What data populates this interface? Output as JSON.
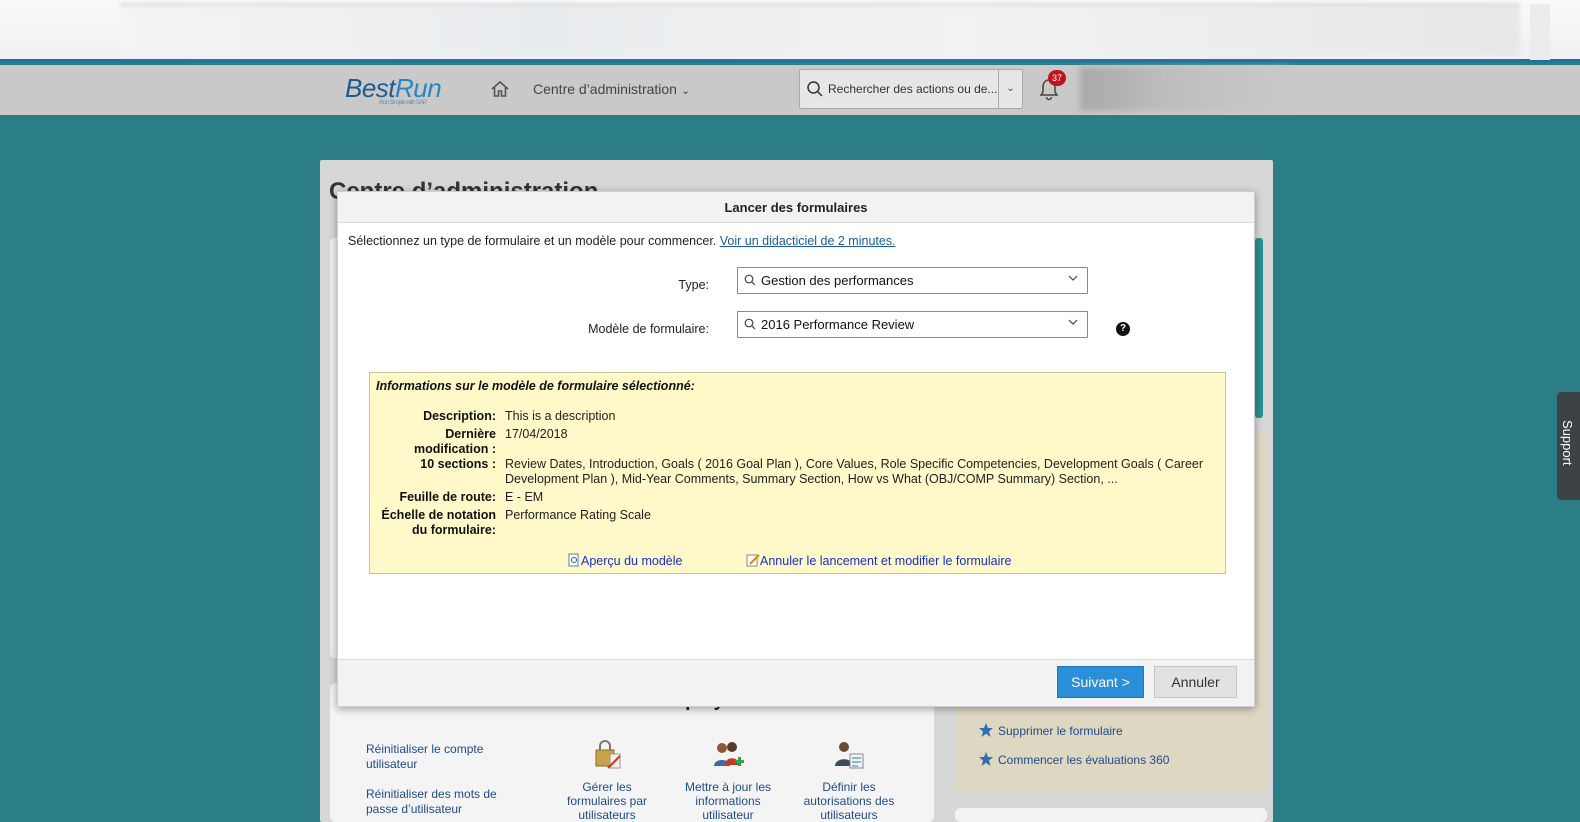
{
  "header": {
    "logo_main": "Best",
    "logo_accent": "Run",
    "logo_tagline": "Run Simple with SAP",
    "admin_menu_label": "Centre d’administration",
    "search_placeholder": "Rechercher des actions ou de...",
    "notification_count": "37"
  },
  "background": {
    "page_title": "Centre d’administration",
    "employees_section_title": "Gérer les employés",
    "employee_links": [
      "Réinitialiser le compte utilisateur",
      "Réinitialiser des mots de passe d’utilisateur"
    ],
    "employee_tiles": [
      "Gérer les formulaires par utilisateurs",
      "Mettre à jour les informations utilisateur",
      "Définir les autorisations des utilisateurs"
    ],
    "right_links": [
      "Supprimer le formulaire",
      "Commencer les évaluations 360"
    ],
    "support_label": "Support"
  },
  "modal": {
    "title": "Lancer des formulaires",
    "intro_text": "Sélectionnez un type de formulaire et un modèle pour commencer.",
    "intro_link": "Voir un didacticiel de 2 minutes.",
    "type_label": "Type:",
    "type_value": "Gestion des performances",
    "template_label": "Modèle de formulaire:",
    "template_value": "2016 Performance Review",
    "help_symbol": "?",
    "info": {
      "title": "Informations sur le modèle de formulaire sélectionné:",
      "rows": [
        {
          "key": "Description:",
          "value": "This is a description"
        },
        {
          "key": "Dernière modification :",
          "value": "17/04/2018"
        },
        {
          "key": "10 sections :",
          "value": "Review Dates, Introduction, Goals ( 2016 Goal Plan ), Core Values, Role Specific Competencies, Development Goals ( Career Development Plan ), Mid-Year Comments, Summary Section, How vs What (OBJ/COMP Summary) Section, ..."
        },
        {
          "key": "Feuille de route:",
          "value": "E - EM"
        },
        {
          "key": "Échelle de notation du formulaire:",
          "value": "Performance Rating Scale"
        }
      ],
      "preview_link": "Aperçu du modèle",
      "cancel_modify_link": "Annuler le lancement et modifier le formulaire"
    },
    "next_button": "Suivant >",
    "cancel_button": "Annuler"
  }
}
